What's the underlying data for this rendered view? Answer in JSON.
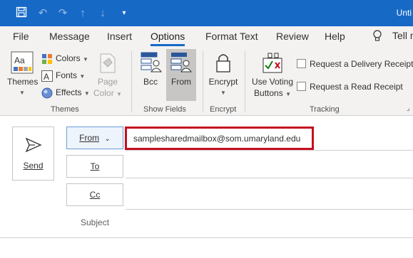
{
  "window": {
    "title": "Unti",
    "quick_access": [
      "save-icon",
      "undo-icon",
      "redo-icon",
      "up-arrow-icon",
      "down-arrow-icon",
      "customize-icon"
    ]
  },
  "tabs": [
    {
      "label": "File"
    },
    {
      "label": "Message"
    },
    {
      "label": "Insert"
    },
    {
      "label": "Options",
      "active": true
    },
    {
      "label": "Format Text"
    },
    {
      "label": "Review"
    },
    {
      "label": "Help"
    }
  ],
  "tell_me": "Tell m",
  "ribbon": {
    "themes_group": {
      "label": "Themes",
      "themes_button": "Themes",
      "colors": "Colors",
      "fonts": "Fonts",
      "effects": "Effects",
      "page_color_line1": "Page",
      "page_color_line2": "Color"
    },
    "show_fields_group": {
      "label": "Show Fields",
      "bcc": "Bcc",
      "from": "From"
    },
    "encrypt_group": {
      "label": "Encrypt",
      "encrypt": "Encrypt"
    },
    "tracking_group": {
      "label": "Tracking",
      "voting_line1": "Use Voting",
      "voting_line2": "Buttons",
      "delivery_receipt": "Request a Delivery Receipt",
      "read_receipt": "Request a Read Receipt"
    }
  },
  "compose": {
    "send": "Send",
    "from_label": "From",
    "from_address": "samplesharedmailbox@som.umaryland.edu",
    "to_label": "To",
    "cc_label": "Cc",
    "subject_label": "Subject"
  },
  "colors": {
    "title_bar": "#1769c6",
    "ribbon_bg": "#f3f2f1",
    "highlight_box": "#c50f1f",
    "accent": "#1769c6"
  }
}
